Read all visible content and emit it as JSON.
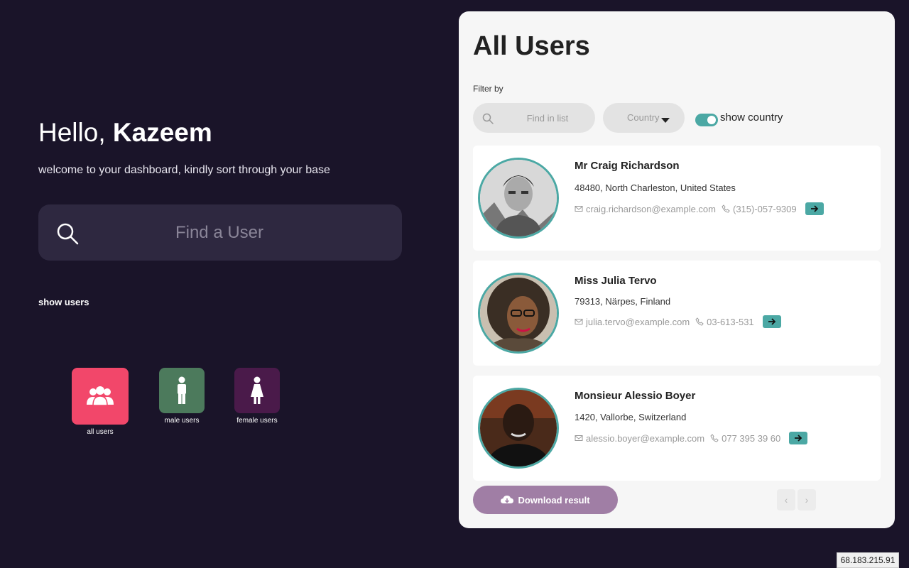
{
  "greeting": {
    "hello": "Hello, ",
    "name": "Kazeem"
  },
  "subtitle": "welcome to your dashboard, kindly sort through your base",
  "search": {
    "placeholder": "Find a User"
  },
  "show_users_label": "show users",
  "tiles": [
    {
      "label": "all users",
      "icon": "users-group-icon",
      "color": "#f2476a"
    },
    {
      "label": "male users",
      "icon": "male-icon",
      "color": "#4c7a5c"
    },
    {
      "label": "female users",
      "icon": "female-icon",
      "color": "#4a1a4a"
    }
  ],
  "panel": {
    "title": "All Users",
    "filter_label": "Filter by",
    "find_placeholder": "Find in list",
    "country_label": "Country",
    "show_country_label": "show country",
    "show_country_on": true
  },
  "users": [
    {
      "name": "Mr Craig Richardson",
      "address": "48480, North Charleston, United States",
      "email": "craig.richardson@example.com",
      "phone": "(315)-057-9309"
    },
    {
      "name": "Miss Julia Tervo",
      "address": "79313, Närpes, Finland",
      "email": "julia.tervo@example.com",
      "phone": "03-613-531"
    },
    {
      "name": "Monsieur Alessio Boyer",
      "address": "1420, Vallorbe, Switzerland",
      "email": "alessio.boyer@example.com",
      "phone": "077 395 39 60"
    }
  ],
  "download_label": "Download result",
  "pager": {
    "prev": "‹",
    "next": "›"
  },
  "ip_badge": "68.183.215.91",
  "colors": {
    "accent": "#4ba8a4",
    "background": "#1a1429",
    "download": "#a07ea5"
  }
}
